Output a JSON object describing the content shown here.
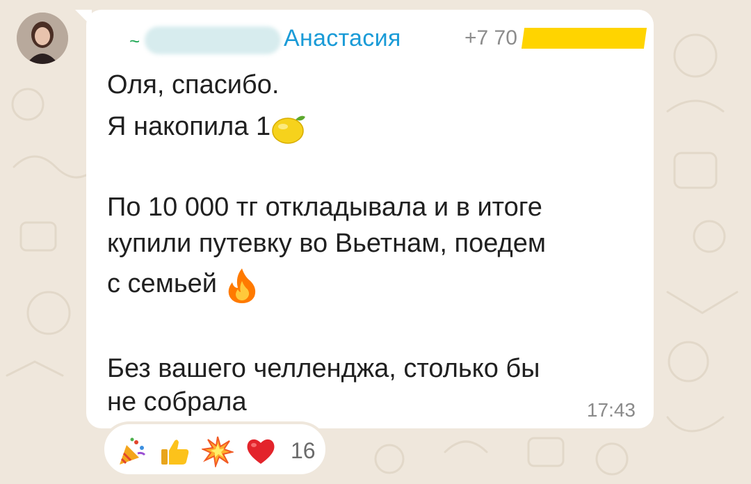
{
  "sender": {
    "prefix": "~",
    "name": "Анастасия",
    "phone_visible": "+7 70"
  },
  "message": {
    "line1": "Оля, спасибо.",
    "line2": "Я накопила 1",
    "line2_emoji": "lemon-icon",
    "line3": "По 10 000 тг откладывала и в итоге",
    "line4": "купили путевку во Вьетнам, поедем",
    "line5": "с семьей",
    "line5_emoji": "fire-icon",
    "line6": "Без вашего челленджа, столько бы",
    "line7": "не собрала",
    "time": "17:43"
  },
  "reactions": {
    "icons": [
      "party-popper-icon",
      "thumbs-up-icon",
      "collision-icon",
      "red-heart-icon"
    ],
    "count": "16"
  },
  "colors": {
    "sender_name": "#1a9bd7",
    "bubble": "#ffffff",
    "background": "#efe7dc",
    "redaction": "#ffd400"
  }
}
